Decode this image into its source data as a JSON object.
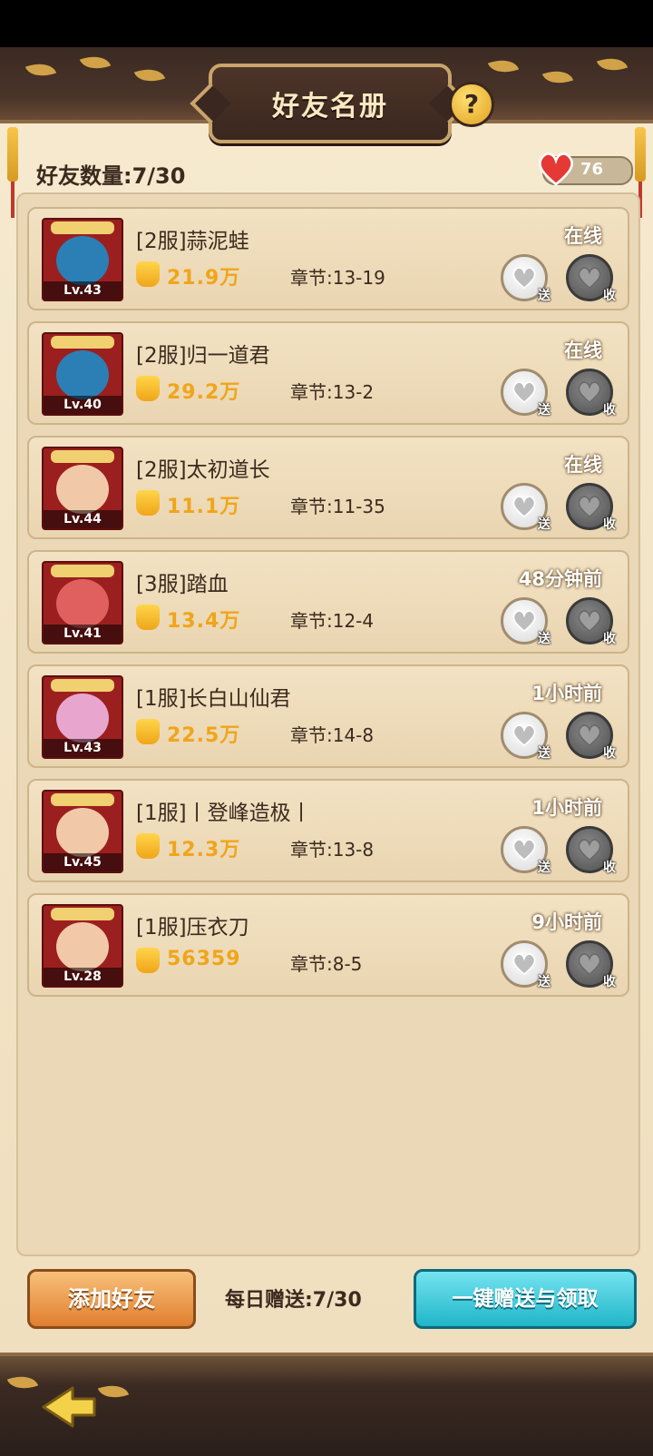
{
  "header": {
    "title": "好友名册",
    "help_label": "?"
  },
  "friend_count": "好友数量:7/30",
  "hearts": {
    "count": "76"
  },
  "friends": [
    {
      "name": "[2服]蒜泥蛙",
      "level": "Lv.43",
      "power": "21.9万",
      "chapter": "章节:13-19",
      "status": "在线",
      "send": "送",
      "receive": "收"
    },
    {
      "name": "[2服]归一道君",
      "level": "Lv.40",
      "power": "29.2万",
      "chapter": "章节:13-2",
      "status": "在线",
      "send": "送",
      "receive": "收"
    },
    {
      "name": "[2服]太初道长",
      "level": "Lv.44",
      "power": "11.1万",
      "chapter": "章节:11-35",
      "status": "在线",
      "send": "送",
      "receive": "收"
    },
    {
      "name": "[3服]踏血",
      "level": "Lv.41",
      "power": "13.4万",
      "chapter": "章节:12-4",
      "status": "48分钟前",
      "send": "送",
      "receive": "收"
    },
    {
      "name": "[1服]长白山仙君",
      "level": "Lv.43",
      "power": "22.5万",
      "chapter": "章节:14-8",
      "status": "1小时前",
      "send": "送",
      "receive": "收"
    },
    {
      "name": "[1服]丨登峰造极丨",
      "level": "Lv.45",
      "power": "12.3万",
      "chapter": "章节:13-8",
      "status": "1小时前",
      "send": "送",
      "receive": "收"
    },
    {
      "name": "[1服]压衣刀",
      "level": "Lv.28",
      "power": "56359",
      "chapter": "章节:8-5",
      "status": "9小时前",
      "send": "送",
      "receive": "收"
    }
  ],
  "footer": {
    "add_friend": "添加好友",
    "daily_send": "每日赠送:7/30",
    "one_click": "一键赠送与领取"
  }
}
